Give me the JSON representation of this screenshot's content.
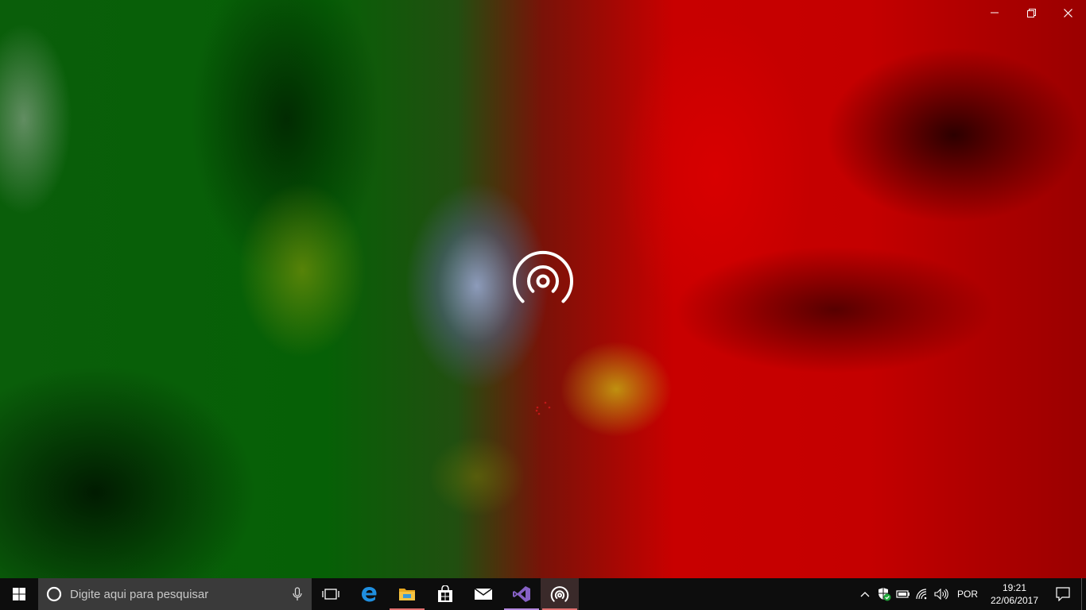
{
  "window": {
    "controls": {
      "minimize_icon": "minimize-icon",
      "restore_icon": "restore-icon",
      "close_icon": "close-icon"
    },
    "center_logo_icon": "broadcast-icon",
    "spinner_color": "#c01818"
  },
  "taskbar": {
    "search": {
      "placeholder": "Digite aqui para pesquisar",
      "icon": "cortana-icon",
      "mic_icon": "microphone-icon"
    },
    "pinned": [
      {
        "name": "task-view",
        "icon": "task-view-icon"
      },
      {
        "name": "edge",
        "icon": "edge-icon"
      },
      {
        "name": "file-explorer",
        "icon": "folder-icon",
        "running": true
      },
      {
        "name": "store",
        "icon": "store-icon"
      },
      {
        "name": "mail",
        "icon": "mail-icon"
      },
      {
        "name": "visual-studio",
        "icon": "visual-studio-icon",
        "running": true
      },
      {
        "name": "broadcast-app",
        "icon": "broadcast-icon",
        "running": true,
        "active": true
      }
    ],
    "tray": {
      "language": "POR",
      "time": "19:21",
      "date": "22/06/2017"
    }
  },
  "colors": {
    "taskbar_bg": "#0d0d0d",
    "search_bg": "#3a3a3a",
    "edge_blue": "#1f8fe0",
    "vs_purple": "#8661c5",
    "folder_yellow": "#f5c342",
    "running_indicator": "#e07070"
  }
}
